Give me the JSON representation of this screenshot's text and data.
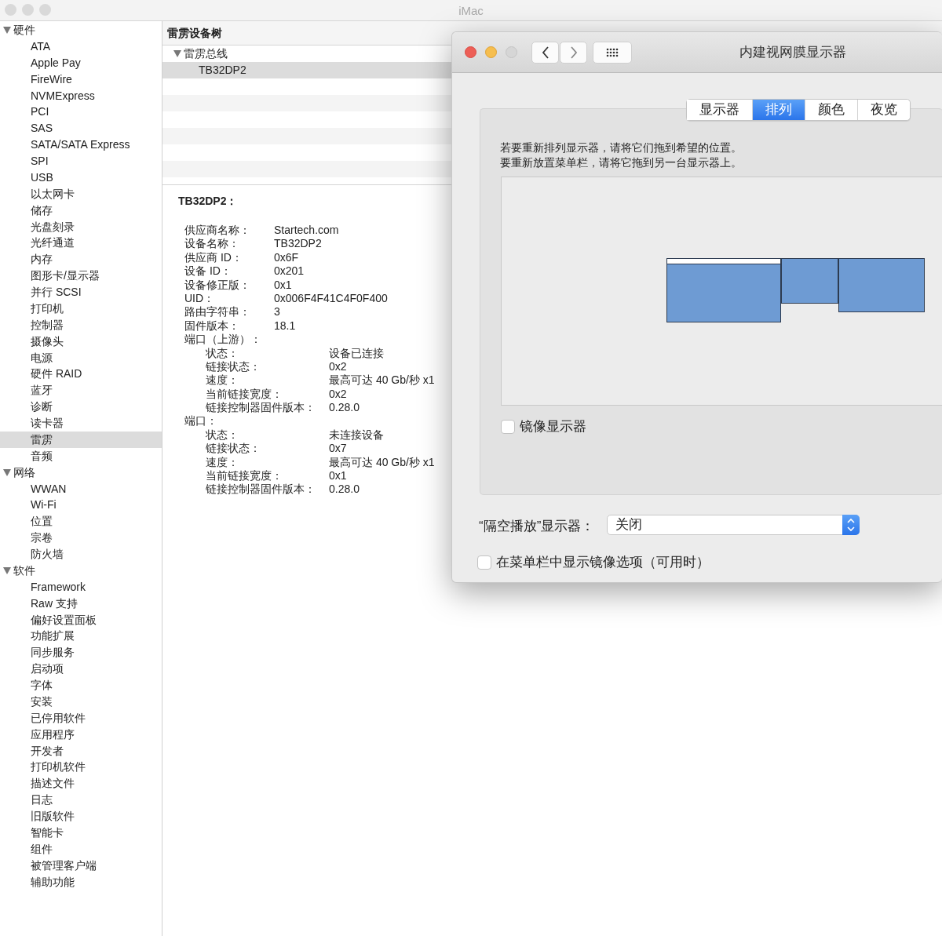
{
  "window": {
    "title": "iMac"
  },
  "sidebar": {
    "items": [
      {
        "label": "硬件",
        "expanded": true,
        "children": [
          {
            "label": "ATA",
            "selected": false
          },
          {
            "label": "Apple Pay",
            "selected": false
          },
          {
            "label": "FireWire",
            "selected": false
          },
          {
            "label": "NVMExpress",
            "selected": false
          },
          {
            "label": "PCI",
            "selected": false
          },
          {
            "label": "SAS",
            "selected": false
          },
          {
            "label": "SATA/SATA Express",
            "selected": false
          },
          {
            "label": "SPI",
            "selected": false
          },
          {
            "label": "USB",
            "selected": false
          },
          {
            "label": "以太网卡",
            "selected": false
          },
          {
            "label": "储存",
            "selected": false
          },
          {
            "label": "光盘刻录",
            "selected": false
          },
          {
            "label": "光纤通道",
            "selected": false
          },
          {
            "label": "内存",
            "selected": false
          },
          {
            "label": "图形卡/显示器",
            "selected": false
          },
          {
            "label": "并行 SCSI",
            "selected": false
          },
          {
            "label": "打印机",
            "selected": false
          },
          {
            "label": "控制器",
            "selected": false
          },
          {
            "label": "摄像头",
            "selected": false
          },
          {
            "label": "电源",
            "selected": false
          },
          {
            "label": "硬件 RAID",
            "selected": false
          },
          {
            "label": "蓝牙",
            "selected": false
          },
          {
            "label": "诊断",
            "selected": false
          },
          {
            "label": "读卡器",
            "selected": false
          },
          {
            "label": "雷雳",
            "selected": true
          },
          {
            "label": "音频",
            "selected": false
          }
        ]
      },
      {
        "label": "网络",
        "expanded": true,
        "children": [
          {
            "label": "WWAN",
            "selected": false
          },
          {
            "label": "Wi-Fi",
            "selected": false
          },
          {
            "label": "位置",
            "selected": false
          },
          {
            "label": "宗卷",
            "selected": false
          },
          {
            "label": "防火墙",
            "selected": false
          }
        ]
      },
      {
        "label": "软件",
        "expanded": true,
        "children": [
          {
            "label": "Framework",
            "selected": false
          },
          {
            "label": "Raw 支持",
            "selected": false
          },
          {
            "label": "偏好设置面板",
            "selected": false
          },
          {
            "label": "功能扩展",
            "selected": false
          },
          {
            "label": "同步服务",
            "selected": false
          },
          {
            "label": "启动项",
            "selected": false
          },
          {
            "label": "字体",
            "selected": false
          },
          {
            "label": "安装",
            "selected": false
          },
          {
            "label": "已停用软件",
            "selected": false
          },
          {
            "label": "应用程序",
            "selected": false
          },
          {
            "label": "开发者",
            "selected": false
          },
          {
            "label": "打印机软件",
            "selected": false
          },
          {
            "label": "描述文件",
            "selected": false
          },
          {
            "label": "日志",
            "selected": false
          },
          {
            "label": "旧版软件",
            "selected": false
          },
          {
            "label": "智能卡",
            "selected": false
          },
          {
            "label": "组件",
            "selected": false
          },
          {
            "label": "被管理客户端",
            "selected": false
          },
          {
            "label": "辅助功能",
            "selected": false
          }
        ]
      }
    ]
  },
  "device_tree": {
    "header": "雷雳设备树",
    "items": [
      {
        "label": "雷雳总线",
        "expanded": true,
        "children": [
          {
            "label": "TB32DP2",
            "selected": true
          }
        ]
      }
    ]
  },
  "details": {
    "title": "TB32DP2：",
    "properties": [
      {
        "label": "供应商名称：",
        "value": "Startech.com"
      },
      {
        "label": "设备名称：",
        "value": "TB32DP2"
      },
      {
        "label": "供应商 ID：",
        "value": "0x6F"
      },
      {
        "label": "设备 ID：",
        "value": "0x201"
      },
      {
        "label": "设备修正版：",
        "value": "0x1"
      },
      {
        "label": "UID：",
        "value": "0x006F4F41C4F0F400"
      },
      {
        "label": "路由字符串：",
        "value": "3"
      },
      {
        "label": "固件版本：",
        "value": "18.1"
      },
      {
        "label": "端口（上游）：",
        "children": [
          {
            "label": "状态：",
            "value": "设备已连接"
          },
          {
            "label": "链接状态：",
            "value": "0x2"
          },
          {
            "label": "速度：",
            "value": "最高可达 40 Gb/秒 x1"
          },
          {
            "label": "当前链接宽度：",
            "value": "0x2"
          },
          {
            "label": "链接控制器固件版本：",
            "value": "0.28.0"
          }
        ]
      },
      {
        "label": "端口：",
        "children": [
          {
            "label": "状态：",
            "value": "未连接设备"
          },
          {
            "label": "链接状态：",
            "value": "0x7"
          },
          {
            "label": "速度：",
            "value": "最高可达 40 Gb/秒 x1"
          },
          {
            "label": "当前链接宽度：",
            "value": "0x1"
          },
          {
            "label": "链接控制器固件版本：",
            "value": "0.28.0"
          }
        ]
      }
    ]
  },
  "dialog": {
    "title": "内建视网膜显示器",
    "tabs": [
      {
        "label": "显示器",
        "selected": false
      },
      {
        "label": "排列",
        "selected": true
      },
      {
        "label": "颜色",
        "selected": false
      },
      {
        "label": "夜览",
        "selected": false
      }
    ],
    "instructions": [
      "若要重新排列显示器，请将它们拖到希望的位置。",
      "要重新放置菜单栏，请将它拖到另一台显示器上。"
    ],
    "displays": [
      {
        "menu_bar": true
      },
      {
        "menu_bar": false
      },
      {
        "menu_bar": false
      }
    ],
    "mirror_displays": {
      "label": "镜像显示器",
      "checked": false
    },
    "airplay": {
      "label": "“隔空播放”显示器：",
      "value": "关闭"
    },
    "show_mirroring": {
      "label": "在菜单栏中显示镜像选项（可用时）",
      "checked": false
    }
  }
}
